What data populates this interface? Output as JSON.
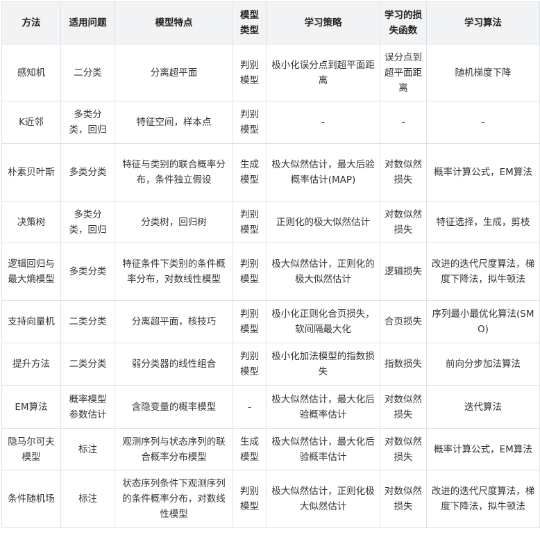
{
  "headers": [
    "方法",
    "适用问题",
    "模型特点",
    "模型类型",
    "学习策略",
    "学习的损失函数",
    "学习算法"
  ],
  "rows": [
    [
      "感知机",
      "二分类",
      "分离超平面",
      "判别模型",
      "极小化误分点到超平面距离",
      "误分点到超平面距离",
      "随机梯度下降"
    ],
    [
      "K近邻",
      "多类分类，回归",
      "特征空间，样本点",
      "判别模型",
      "-",
      "-",
      "-"
    ],
    [
      "朴素贝叶斯",
      "多类分类",
      "特征与类别的联合概率分布，条件独立假设",
      "生成模型",
      "极大似然估计，最大后验概率估计(MAP)",
      "对数似然损失",
      "概率计算公式，EM算法"
    ],
    [
      "决策树",
      "多类分类，回归",
      "分类树，回归树",
      "判别模型",
      "正则化的极大似然估计",
      "对数似然损失",
      "特征选择，生成，剪枝"
    ],
    [
      "逻辑回归与最大熵模型",
      "多类分类",
      "特征条件下类别的条件概率分布，对数线性模型",
      "判别模型",
      "极大似然估计，正则化的极大似然估计",
      "逻辑损失",
      "改进的迭代尺度算法，梯度下降法，拟牛顿法"
    ],
    [
      "支持向量机",
      "二类分类",
      "分离超平面，核技巧",
      "判别模型",
      "极小化正则化合页损失，软间隔最大化",
      "合页损失",
      "序列最小最优化算法(SMO)"
    ],
    [
      "提升方法",
      "二类分类",
      "弱分类器的线性组合",
      "判别模型",
      "极小化加法模型的指数损失",
      "指数损失",
      "前向分步加法算法"
    ],
    [
      "EM算法",
      "概率模型参数估计",
      "含隐变量的概率模型",
      "-",
      "极大似然估计，最大化后验概率估计",
      "对数似然损失",
      "迭代算法"
    ],
    [
      "隐马尔可夫模型",
      "标注",
      "观测序列与状态序列的联合概率分布模型",
      "生成模型",
      "极大似然估计，最大化后验概率估计",
      "对数似然损失",
      "概率计算公式，EM算法"
    ],
    [
      "条件随机场",
      "标注",
      "状态序列条件下观测序列的条件概率分布，对数线性模型",
      "判别模型",
      "极大似然估计，正则化极大似然估计",
      "对数似然损失",
      "改进的迭代尺度算法，梯度下降法，拟牛顿法"
    ]
  ]
}
